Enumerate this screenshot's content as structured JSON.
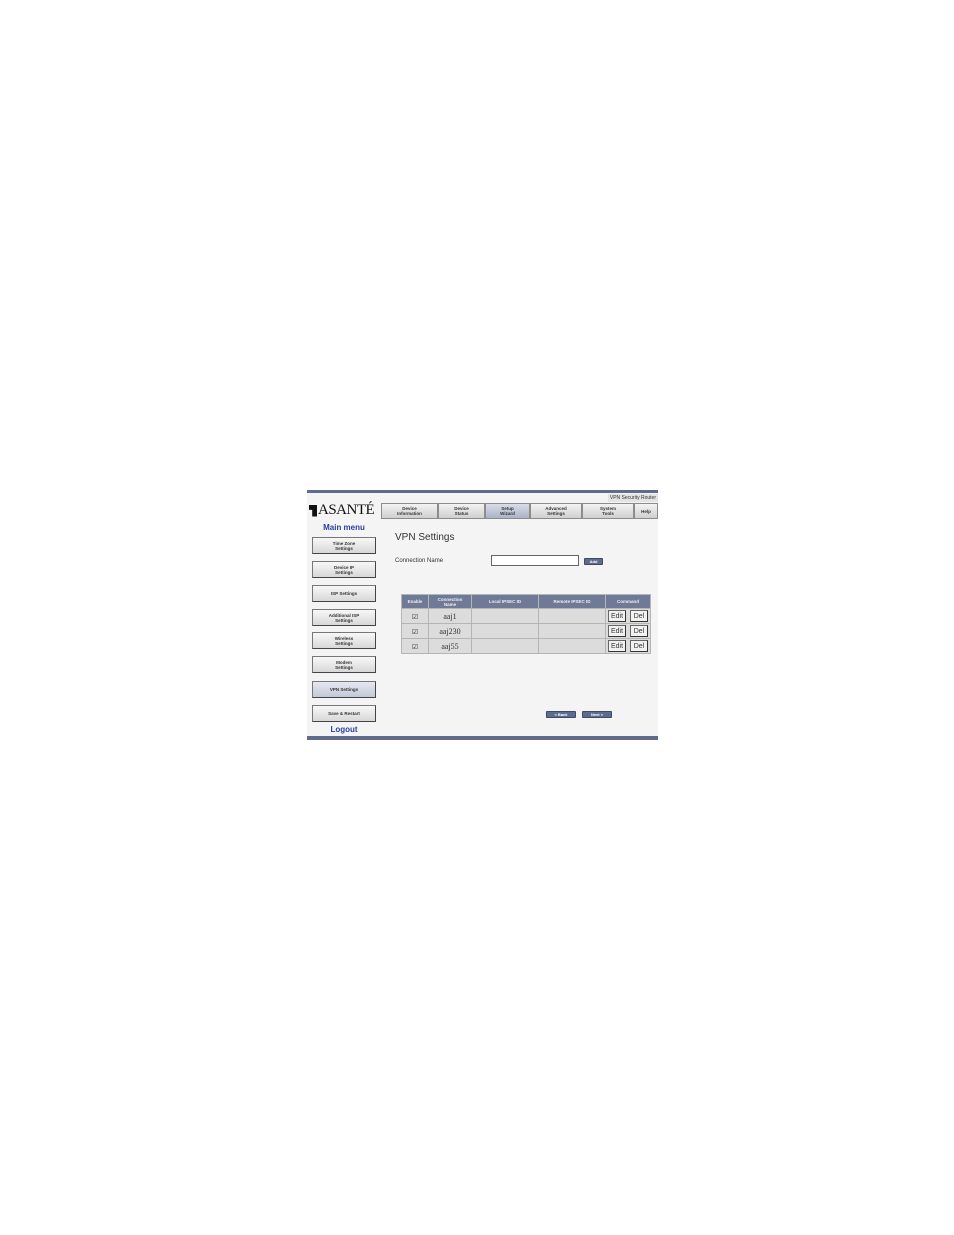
{
  "product_label": "VPN Security Router",
  "logo_text": "ASANTÉ",
  "top_nav": [
    {
      "label": "Device\nInformation"
    },
    {
      "label": "Device\nStatus"
    },
    {
      "label": "Setup\nWizard"
    },
    {
      "label": "Advanced\nSettings"
    },
    {
      "label": "System\nTools"
    },
    {
      "label": "Help"
    }
  ],
  "sidebar": {
    "title": "Main menu",
    "items": [
      {
        "label": "Time Zone\nSettings"
      },
      {
        "label": "Device IP\nSettings"
      },
      {
        "label": "ISP Settings"
      },
      {
        "label": "Additional ISP\nSettings"
      },
      {
        "label": "Wireless\nSettings"
      },
      {
        "label": "Modem\nSettings"
      },
      {
        "label": "VPN Settings"
      },
      {
        "label": "Save & Restart"
      }
    ],
    "logout": "Logout"
  },
  "main": {
    "title": "VPN Settings",
    "connection_name_label": "Connection Name",
    "connection_name_value": "",
    "add_button": "Add",
    "table": {
      "headers": [
        "Enable",
        "Connection\nName",
        "Local IPSEC ID",
        "Remote IPSEC ID",
        "Command"
      ],
      "rows": [
        {
          "enabled": "☑",
          "name": "aaj1",
          "local_id": "",
          "remote_id": ""
        },
        {
          "enabled": "☑",
          "name": "aaj230",
          "local_id": "",
          "remote_id": ""
        },
        {
          "enabled": "☑",
          "name": "aaj55",
          "local_id": "",
          "remote_id": ""
        }
      ],
      "edit_label": "Edit",
      "del_label": "Del"
    },
    "back_button": "< Back",
    "next_button": "Next >"
  },
  "colors": {
    "accent": "#5e6d8e",
    "header": "#6e7a96",
    "menu_text": "#2a3fa0"
  }
}
